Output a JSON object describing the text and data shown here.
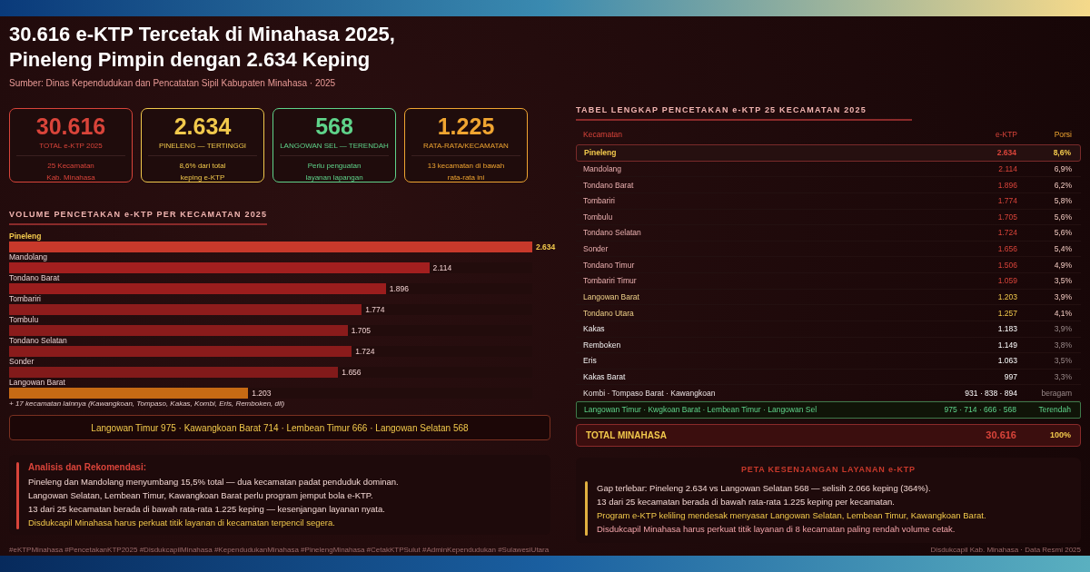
{
  "title_lines": [
    "30.616 e-KTP Tercetak di Minahasa 2025,",
    "Pineleng Pimpin dengan 2.634 Keping"
  ],
  "source": "Sumber: Dinas Kependudukan dan Pencatatan Sipil Kabupaten Minahasa · 2025",
  "stat_cards": [
    {
      "value": "30.616",
      "label": "TOTAL e-KTP 2025",
      "note_lines": [
        "25 Kecamatan",
        "Kab. Minahasa"
      ],
      "color": "#d9443a"
    },
    {
      "value": "2.634",
      "label": "PINELENG — TERTINGGI",
      "note_lines": [
        "8,6% dari total",
        "keping e-KTP"
      ],
      "color": "#f2c94c"
    },
    {
      "value": "568",
      "label": "LANGOWAN SEL — TERENDAH",
      "note_lines": [
        "Perlu penguatan",
        "layanan lapangan"
      ],
      "color": "#5fd38a"
    },
    {
      "value": "1.225",
      "label": "RATA-RATA/KECAMATAN",
      "note_lines": [
        "13 kecamatan di bawah",
        "rata-rata ini"
      ],
      "color": "#f0a531"
    }
  ],
  "bar_chart": {
    "title": "VOLUME PENCETAKAN e-KTP PER KECAMATAN 2025",
    "items": [
      {
        "name": "Pineleng",
        "value": "2.634",
        "level": 1.0,
        "color": "#c8392b",
        "kind": "top"
      },
      {
        "name": "Mandolang",
        "value": "2.114",
        "level": 0.803,
        "color": "#a31f1f",
        "kind": "normal"
      },
      {
        "name": "Tondano Barat",
        "value": "1.896",
        "level": 0.72,
        "color": "#9b1d1d",
        "kind": "normal"
      },
      {
        "name": "Tombariri",
        "value": "1.774",
        "level": 0.674,
        "color": "#8e1c1c",
        "kind": "normal"
      },
      {
        "name": "Tombulu",
        "value": "1.705",
        "level": 0.647,
        "color": "#8a1b1b",
        "kind": "normal"
      },
      {
        "name": "Tondano Selatan",
        "value": "1.724",
        "level": 0.655,
        "color": "#8a1b1b",
        "kind": "normal"
      },
      {
        "name": "Sonder",
        "value": "1.656",
        "level": 0.629,
        "color": "#821a1a",
        "kind": "normal"
      },
      {
        "name": "Langowan Barat",
        "value": "1.203",
        "level": 0.457,
        "color": "#c66a14",
        "kind": "normal"
      }
    ],
    "more_note": "+ 17 kecamatan lainnya (Kawangkoan, Tompaso, Kakas, Kombi, Eris, Remboken, dll)",
    "lowest_note": "Langowan Timur 975 · Kawangkoan Barat 714 · Lembean Timur 666 · Langowan Selatan 568"
  },
  "analysis": {
    "title": "Analisis dan Rekomendasi:",
    "lines": [
      {
        "text": "Pineleng dan Mandolang menyumbang 15,5% total — dua kecamatan padat penduduk dominan.",
        "kind": "normal"
      },
      {
        "text": "Langowan Selatan, Lembean Timur, Kawangkoan Barat perlu program jemput bola e-KTP.",
        "kind": "normal"
      },
      {
        "text": "13 dari 25 kecamatan berada di bawah rata-rata 1.225 keping — kesenjangan layanan nyata.",
        "kind": "normal"
      },
      {
        "text": "Disdukcapil Minahasa harus perkuat titik layanan di kecamatan terpencil segera.",
        "kind": "accent"
      }
    ]
  },
  "hashtags": "#eKTPMinahasa #PencetakanKTP2025 #DisdukcapilMinahasa #KependudukanMinahasa #PinelengMinahasa #CetakKTPSulut #AdminKependudukan #SulawesiUtara",
  "table": {
    "title": "TABEL LENGKAP PENCETAKAN e-KTP 25 KECAMATAN 2025",
    "columns": [
      "Kecamatan",
      "e-KTP",
      "Porsi"
    ],
    "rows": [
      {
        "name": "Pineleng",
        "value": "2.634",
        "share": "8,6%",
        "kind": "top"
      },
      {
        "name": "Mandolang",
        "value": "2.114",
        "share": "6,9%",
        "kind": "high"
      },
      {
        "name": "Tondano Barat",
        "value": "1.896",
        "share": "6,2%",
        "kind": "high"
      },
      {
        "name": "Tombariri",
        "value": "1.774",
        "share": "5,8%",
        "kind": "high"
      },
      {
        "name": "Tombulu",
        "value": "1.705",
        "share": "5,6%",
        "kind": "high"
      },
      {
        "name": "Tondano Selatan",
        "value": "1.724",
        "share": "5,6%",
        "kind": "high"
      },
      {
        "name": "Sonder",
        "value": "1.656",
        "share": "5,4%",
        "kind": "high"
      },
      {
        "name": "Tondano Timur",
        "value": "1.506",
        "share": "4,9%",
        "kind": "high"
      },
      {
        "name": "Tombariri Timur",
        "value": "1.059",
        "share": "3,5%",
        "kind": "high"
      },
      {
        "name": "Langowan Barat",
        "value": "1.203",
        "share": "3,9%",
        "kind": "mid"
      },
      {
        "name": "Tondano Utara",
        "value": "1.257",
        "share": "4,1%",
        "kind": "mid"
      },
      {
        "name": "Kakas",
        "value": "1.183",
        "share": "3,9%",
        "kind": "base"
      },
      {
        "name": "Remboken",
        "value": "1.149",
        "share": "3,8%",
        "kind": "base"
      },
      {
        "name": "Eris",
        "value": "1.063",
        "share": "3,5%",
        "kind": "base"
      },
      {
        "name": "Kakas Barat",
        "value": "997",
        "share": "3,3%",
        "kind": "base"
      },
      {
        "name": "Kombi · Tompaso Barat · Kawangkoan",
        "value": "931 · 838 · 894",
        "share": "beragam",
        "kind": "group"
      },
      {
        "name": "Langowan Timur · Kwgkoan Barat · Lembean Timur · Langowan Sel",
        "value": "975 · 714 · 666 · 568",
        "share": "Terendah",
        "kind": "lowest"
      }
    ],
    "total": {
      "name": "TOTAL MINAHASA",
      "value": "30.616",
      "share": "100%"
    }
  },
  "gap_panel": {
    "title": "PETA KESENJANGAN LAYANAN e-KTP",
    "lines": [
      {
        "text": "Gap terlebar: Pineleng 2.634 vs Langowan Selatan 568 — selisih 2.066 keping (364%).",
        "kind": "normal"
      },
      {
        "text": "13 dari 25 kecamatan berada di bawah rata-rata 1.225 keping per kecamatan.",
        "kind": "normal"
      },
      {
        "text": "Program e-KTP keliling mendesak menyasar Langowan Selatan, Lembean Timur, Kawangkoan Barat.",
        "kind": "accent"
      },
      {
        "text": "Disdukcapil Minahasa harus perkuat titik layanan di 8 kecamatan paling rendah volume cetak.",
        "kind": "pink"
      }
    ]
  },
  "credit": "Disdukcapil Kab. Minahasa · Data Resmi 2025"
}
